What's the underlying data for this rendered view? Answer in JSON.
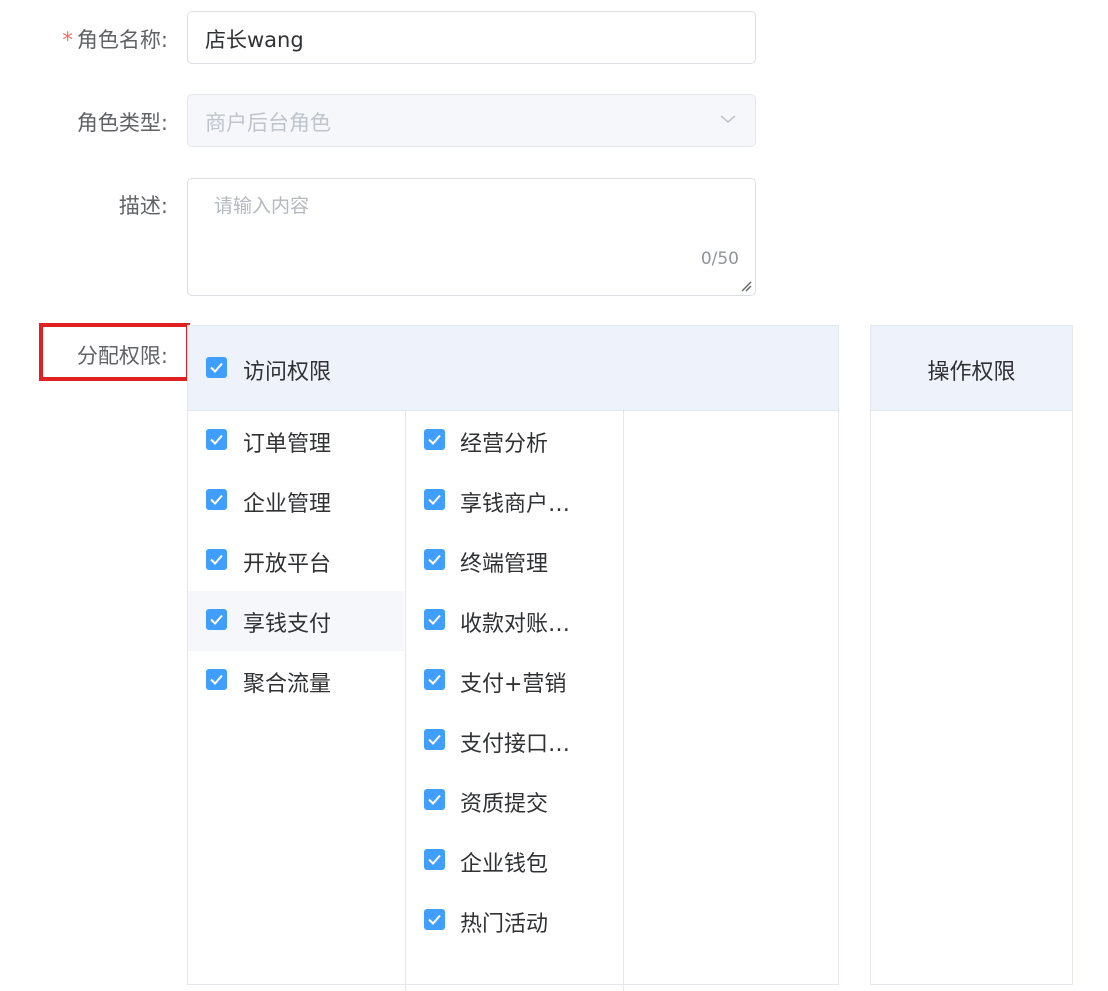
{
  "form": {
    "role_name": {
      "required_mark": "*",
      "label": "角色名称:",
      "value": "店长wang"
    },
    "role_type": {
      "label": "角色类型:",
      "value": "商户后台角色",
      "icon": "chevron-down-icon"
    },
    "description": {
      "label": "描述:",
      "placeholder": "请输入内容",
      "counter": "0/50"
    },
    "permissions_label": "分配权限:"
  },
  "permissions": {
    "header": {
      "label": "访问权限",
      "checked": true
    },
    "column1": [
      {
        "label": "订单管理",
        "checked": true
      },
      {
        "label": "企业管理",
        "checked": true
      },
      {
        "label": "开放平台",
        "checked": true
      },
      {
        "label": "享钱支付",
        "checked": true,
        "highlighted": true
      },
      {
        "label": "聚合流量",
        "checked": true
      }
    ],
    "column2": [
      {
        "label": "经营分析",
        "checked": true
      },
      {
        "label": "享钱商户…",
        "checked": true
      },
      {
        "label": "终端管理",
        "checked": true
      },
      {
        "label": "收款对账…",
        "checked": true
      },
      {
        "label": "支付+营销",
        "checked": true
      },
      {
        "label": "支付接口…",
        "checked": true
      },
      {
        "label": "资质提交",
        "checked": true
      },
      {
        "label": "企业钱包",
        "checked": true
      },
      {
        "label": "热门活动",
        "checked": true
      }
    ]
  },
  "operations": {
    "title": "操作权限"
  },
  "colors": {
    "primary": "#409eff",
    "required": "#f56c6c",
    "highlight_box": "#e02121",
    "header_bg": "#eef2fb"
  }
}
